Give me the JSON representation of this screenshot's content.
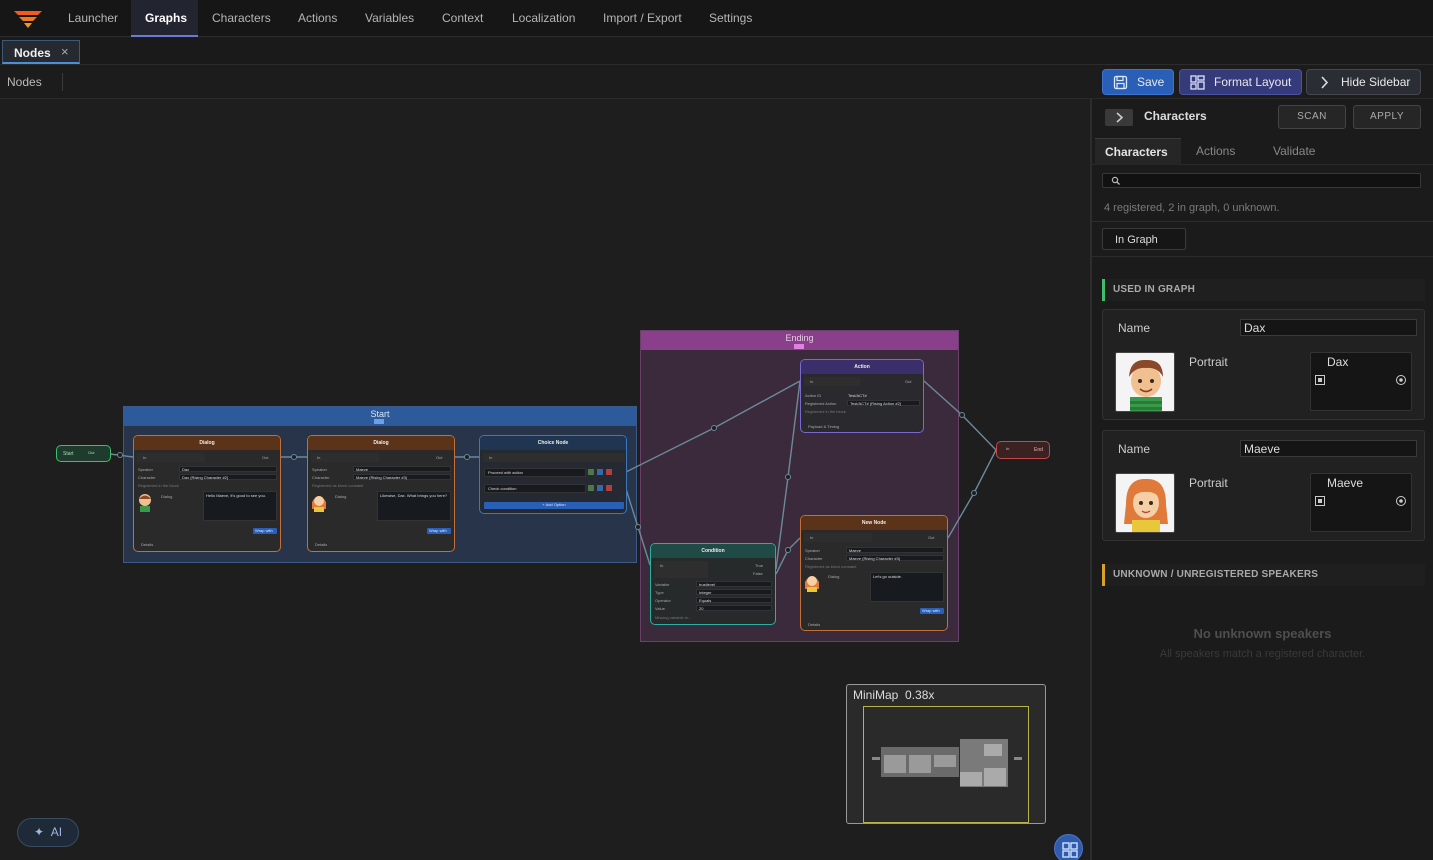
{
  "nav": {
    "items": [
      "Launcher",
      "Graphs",
      "Characters",
      "Actions",
      "Variables",
      "Context",
      "Localization",
      "Import / Export",
      "Settings"
    ],
    "active": "Graphs"
  },
  "tabs": {
    "nodes_label": "Nodes",
    "close_glyph": "×"
  },
  "toolbar": {
    "breadcrumb": "Nodes",
    "save_label": "Save",
    "format_label": "Format Layout",
    "hide_label": "Hide Sidebar"
  },
  "canvas": {
    "start_group": "Start",
    "ending_group": "Ending",
    "start_node": {
      "label": "Start",
      "out": "Out"
    },
    "end_node": {
      "label": "End",
      "in": "In"
    },
    "dialog1": {
      "title": "Dialog",
      "in": "In",
      "out": "Out",
      "speaker_lbl": "Speaker",
      "speaker": "Dax",
      "character_lbl": "Character",
      "character": "Dax (Rising Character #2)",
      "registered": "Registered in the block",
      "text_lbl": "Dialog",
      "text": "Hello Maeve, it's good to see you.",
      "action_btn": "Wrap with",
      "details": "Details"
    },
    "dialog2": {
      "title": "Dialog",
      "in": "In",
      "out": "Out",
      "speaker_lbl": "Speaker",
      "speaker": "Maeve",
      "character_lbl": "Character",
      "character": "Maeve (Rising Character #3)",
      "registered": "Registered as block constant",
      "text_lbl": "Dialog",
      "text": "Likewise, Dax. What brings you here?",
      "action_btn": "Wrap with",
      "details": "Details"
    },
    "choice": {
      "title": "Choice Node",
      "in": "In",
      "opt1": "Proceed with action",
      "opt2": "Check condition",
      "add": "+ Add Option"
    },
    "action": {
      "title": "Action",
      "in": "In",
      "out": "Out",
      "action_id_lbl": "Action ID",
      "action_id": "Test/ACT#",
      "registered_lbl": "Registered Action",
      "registered": "Test/ACT# (Rising Action #2)",
      "note": "Registered in the block",
      "payload": "Payload & Timing"
    },
    "condition": {
      "title": "Condition",
      "in": "In",
      "true": "True",
      "false": "False",
      "variable_lbl": "Variable",
      "variable": "trustlevel",
      "type_lbl": "Type",
      "type": "Integer",
      "operator_lbl": "Operator",
      "operator": "Equals",
      "value_lbl": "Value",
      "value": "20",
      "missing": "Missing variable in..."
    },
    "newnode": {
      "title": "New Node",
      "in": "In",
      "out": "Out",
      "speaker_lbl": "Speaker",
      "speaker": "Maeve",
      "character_lbl": "Character",
      "character": "Maeve (Rising Character #3)",
      "note": "Registered as block constant",
      "text_lbl": "Dialog",
      "text": "Let's go outside.",
      "action_btn": "Wrap with",
      "details": "Details"
    }
  },
  "minimap": {
    "label": "MiniMap",
    "zoom": "0.38x"
  },
  "ai_button": {
    "icon": "sparkle-icon",
    "label": "AI"
  },
  "sidebar": {
    "title": "Characters",
    "scan_label": "SCAN",
    "apply_label": "APPLY",
    "tabs": [
      "Characters",
      "Actions",
      "Validate"
    ],
    "active_tab": "Characters",
    "search_placeholder": "",
    "summary": "4 registered, 2 in graph, 0 unknown.",
    "filter_label": "In Graph",
    "used_heading": "USED IN GRAPH",
    "used_color": "#3fbf6a",
    "characters": [
      {
        "name_label": "Name",
        "name": "Dax",
        "portrait_label": "Portrait",
        "portrait_name": "Dax"
      },
      {
        "name_label": "Name",
        "name": "Maeve",
        "portrait_label": "Portrait",
        "portrait_name": "Maeve"
      }
    ],
    "unknown_heading": "UNKNOWN / UNREGISTERED SPEAKERS",
    "unknown_color": "#d6a229",
    "empty_title": "No unknown speakers",
    "empty_sub": "All speakers match a registered character."
  },
  "colors": {
    "accent": "#6b79d9",
    "save": "#2a5fb8",
    "format": "#343a7a",
    "start_group": "#2d5a9a",
    "ending_group": "#8a3f8a"
  }
}
